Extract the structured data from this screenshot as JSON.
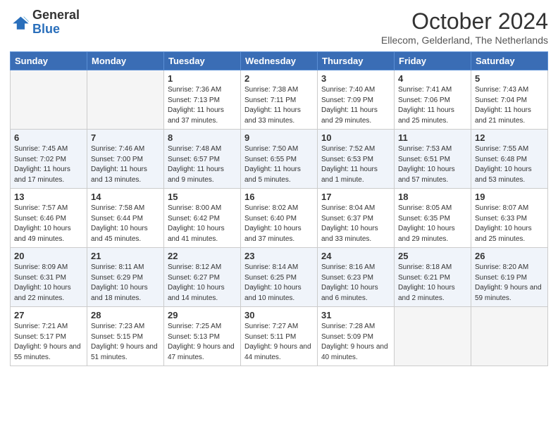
{
  "logo": {
    "general": "General",
    "blue": "Blue"
  },
  "title": "October 2024",
  "location": "Ellecom, Gelderland, The Netherlands",
  "days_of_week": [
    "Sunday",
    "Monday",
    "Tuesday",
    "Wednesday",
    "Thursday",
    "Friday",
    "Saturday"
  ],
  "weeks": [
    [
      {
        "num": "",
        "empty": true
      },
      {
        "num": "",
        "empty": true
      },
      {
        "num": "1",
        "sunrise": "7:36 AM",
        "sunset": "7:13 PM",
        "daylight": "11 hours and 37 minutes."
      },
      {
        "num": "2",
        "sunrise": "7:38 AM",
        "sunset": "7:11 PM",
        "daylight": "11 hours and 33 minutes."
      },
      {
        "num": "3",
        "sunrise": "7:40 AM",
        "sunset": "7:09 PM",
        "daylight": "11 hours and 29 minutes."
      },
      {
        "num": "4",
        "sunrise": "7:41 AM",
        "sunset": "7:06 PM",
        "daylight": "11 hours and 25 minutes."
      },
      {
        "num": "5",
        "sunrise": "7:43 AM",
        "sunset": "7:04 PM",
        "daylight": "11 hours and 21 minutes."
      }
    ],
    [
      {
        "num": "6",
        "sunrise": "7:45 AM",
        "sunset": "7:02 PM",
        "daylight": "11 hours and 17 minutes."
      },
      {
        "num": "7",
        "sunrise": "7:46 AM",
        "sunset": "7:00 PM",
        "daylight": "11 hours and 13 minutes."
      },
      {
        "num": "8",
        "sunrise": "7:48 AM",
        "sunset": "6:57 PM",
        "daylight": "11 hours and 9 minutes."
      },
      {
        "num": "9",
        "sunrise": "7:50 AM",
        "sunset": "6:55 PM",
        "daylight": "11 hours and 5 minutes."
      },
      {
        "num": "10",
        "sunrise": "7:52 AM",
        "sunset": "6:53 PM",
        "daylight": "11 hours and 1 minute."
      },
      {
        "num": "11",
        "sunrise": "7:53 AM",
        "sunset": "6:51 PM",
        "daylight": "10 hours and 57 minutes."
      },
      {
        "num": "12",
        "sunrise": "7:55 AM",
        "sunset": "6:48 PM",
        "daylight": "10 hours and 53 minutes."
      }
    ],
    [
      {
        "num": "13",
        "sunrise": "7:57 AM",
        "sunset": "6:46 PM",
        "daylight": "10 hours and 49 minutes."
      },
      {
        "num": "14",
        "sunrise": "7:58 AM",
        "sunset": "6:44 PM",
        "daylight": "10 hours and 45 minutes."
      },
      {
        "num": "15",
        "sunrise": "8:00 AM",
        "sunset": "6:42 PM",
        "daylight": "10 hours and 41 minutes."
      },
      {
        "num": "16",
        "sunrise": "8:02 AM",
        "sunset": "6:40 PM",
        "daylight": "10 hours and 37 minutes."
      },
      {
        "num": "17",
        "sunrise": "8:04 AM",
        "sunset": "6:37 PM",
        "daylight": "10 hours and 33 minutes."
      },
      {
        "num": "18",
        "sunrise": "8:05 AM",
        "sunset": "6:35 PM",
        "daylight": "10 hours and 29 minutes."
      },
      {
        "num": "19",
        "sunrise": "8:07 AM",
        "sunset": "6:33 PM",
        "daylight": "10 hours and 25 minutes."
      }
    ],
    [
      {
        "num": "20",
        "sunrise": "8:09 AM",
        "sunset": "6:31 PM",
        "daylight": "10 hours and 22 minutes."
      },
      {
        "num": "21",
        "sunrise": "8:11 AM",
        "sunset": "6:29 PM",
        "daylight": "10 hours and 18 minutes."
      },
      {
        "num": "22",
        "sunrise": "8:12 AM",
        "sunset": "6:27 PM",
        "daylight": "10 hours and 14 minutes."
      },
      {
        "num": "23",
        "sunrise": "8:14 AM",
        "sunset": "6:25 PM",
        "daylight": "10 hours and 10 minutes."
      },
      {
        "num": "24",
        "sunrise": "8:16 AM",
        "sunset": "6:23 PM",
        "daylight": "10 hours and 6 minutes."
      },
      {
        "num": "25",
        "sunrise": "8:18 AM",
        "sunset": "6:21 PM",
        "daylight": "10 hours and 2 minutes."
      },
      {
        "num": "26",
        "sunrise": "8:20 AM",
        "sunset": "6:19 PM",
        "daylight": "9 hours and 59 minutes."
      }
    ],
    [
      {
        "num": "27",
        "sunrise": "7:21 AM",
        "sunset": "5:17 PM",
        "daylight": "9 hours and 55 minutes."
      },
      {
        "num": "28",
        "sunrise": "7:23 AM",
        "sunset": "5:15 PM",
        "daylight": "9 hours and 51 minutes."
      },
      {
        "num": "29",
        "sunrise": "7:25 AM",
        "sunset": "5:13 PM",
        "daylight": "9 hours and 47 minutes."
      },
      {
        "num": "30",
        "sunrise": "7:27 AM",
        "sunset": "5:11 PM",
        "daylight": "9 hours and 44 minutes."
      },
      {
        "num": "31",
        "sunrise": "7:28 AM",
        "sunset": "5:09 PM",
        "daylight": "9 hours and 40 minutes."
      },
      {
        "num": "",
        "empty": true
      },
      {
        "num": "",
        "empty": true
      }
    ]
  ]
}
